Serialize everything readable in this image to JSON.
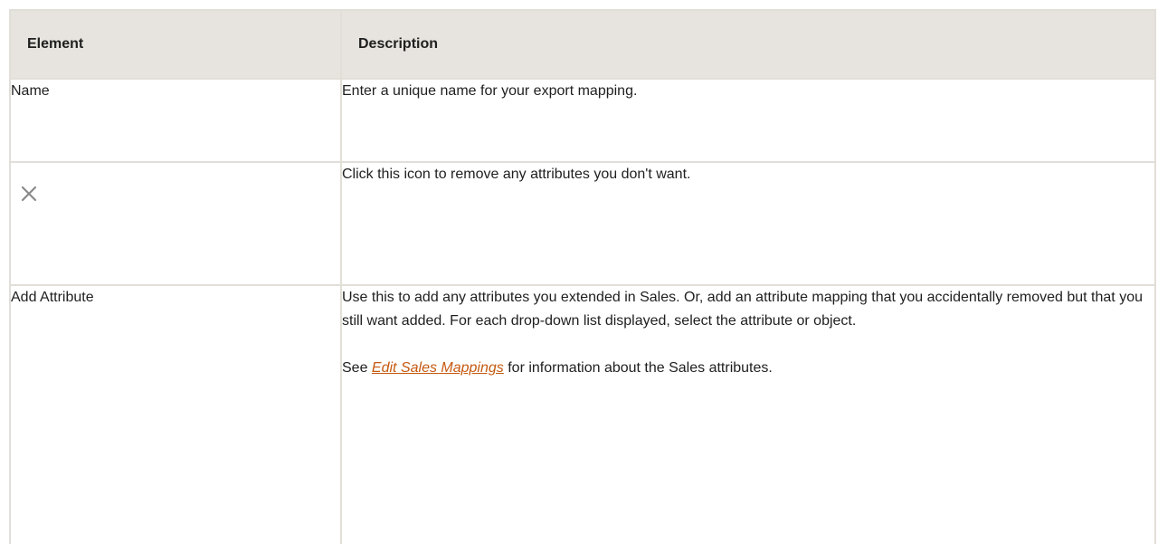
{
  "table": {
    "headers": {
      "element": "Element",
      "description": "Description"
    },
    "rows": [
      {
        "element": "Name",
        "description": "Enter a unique name for your export mapping."
      },
      {
        "element_icon": "close-icon",
        "description": "Click this icon to remove any attributes you don't want."
      },
      {
        "element": "Add Attribute",
        "description_p1": "Use this to add any attributes you extended in Sales. Or, add an attribute mapping that you accidentally removed but that you still want added. For each drop-down list displayed, select the attribute or object.",
        "description_p2_prefix": "See ",
        "description_p2_link": "Edit Sales Mappings",
        "description_p2_suffix": " for information about the Sales attributes."
      }
    ]
  },
  "colors": {
    "header_bg": "#e7e4df",
    "border": "#e2ded8",
    "link": "#c55a11"
  }
}
